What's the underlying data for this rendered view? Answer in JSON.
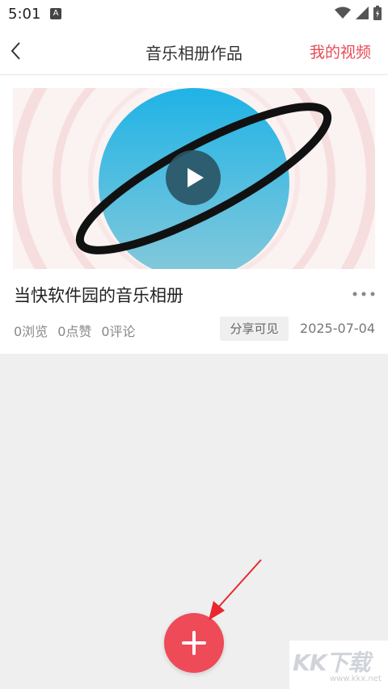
{
  "status_bar": {
    "time": "5:01",
    "notification_badge": "A",
    "icons": [
      "wifi-icon",
      "signal-icon",
      "battery-icon"
    ]
  },
  "header": {
    "title": "音乐相册作品",
    "right_link": "我的视频",
    "accent_color": "#e94a55"
  },
  "video_card": {
    "title": "当快软件园的音乐相册",
    "stats": {
      "views": "0浏览",
      "likes": "0点赞",
      "comments": "0评论"
    },
    "visibility_badge": "分享可见",
    "date": "2025-07-04"
  },
  "fab": {
    "icon": "plus-icon",
    "color": "#ee4a57"
  },
  "watermark": {
    "text": "KK下载",
    "url": "www.kkx.net"
  }
}
